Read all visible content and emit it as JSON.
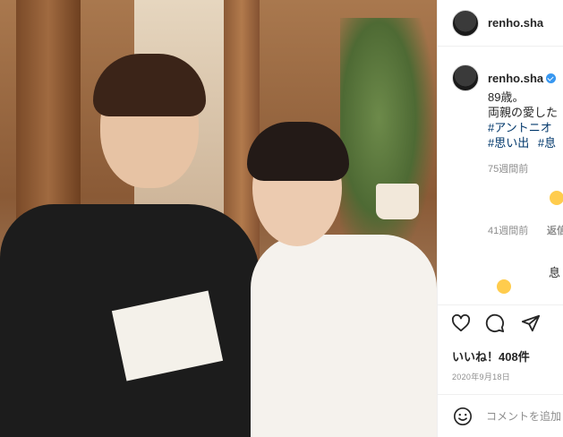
{
  "post": {
    "username": "renho.sha",
    "caption": {
      "line1": "89歳。",
      "line2": "両親の愛した",
      "line3_hashtag": "#アントニオ",
      "line4_hashtag1": "#思い出",
      "line4_hashtag2": "#息"
    },
    "caption_time": "75週間前",
    "comments": [
      {
        "time": "41週間前",
        "reply": "返信"
      },
      {
        "text": "息"
      }
    ],
    "likes": "いいね！408件",
    "date": "2020年9月18日",
    "comment_placeholder": "コメントを追加"
  },
  "colors": {
    "accent": "#3897f0",
    "hashtag": "#00376b",
    "muted": "#8e8e8e"
  },
  "icons": [
    "heart-icon",
    "comment-icon",
    "share-icon",
    "smiley-icon",
    "verified-badge-icon"
  ]
}
